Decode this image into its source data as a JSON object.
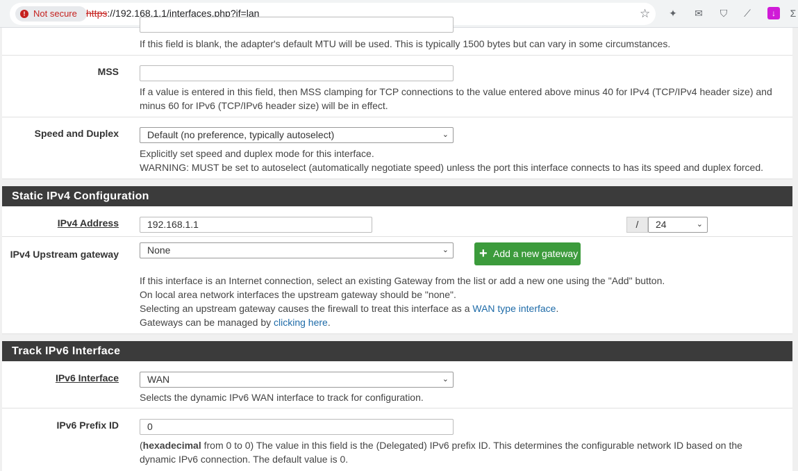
{
  "browser": {
    "security_chip": "Not secure",
    "url_scheme": "https",
    "url_rest": "://192.168.1.1/interfaces.php?if=lan"
  },
  "mtu_row": {
    "help": "If this field is blank, the adapter's default MTU will be used. This is typically 1500 bytes but can vary in some circumstances."
  },
  "mss": {
    "label": "MSS",
    "value": "",
    "help": "If a value is entered in this field, then MSS clamping for TCP connections to the value entered above minus 40 for IPv4 (TCP/IPv4 header size) and minus 60 for IPv6 (TCP/IPv6 header size) will be in effect."
  },
  "speed_duplex": {
    "label": "Speed and Duplex",
    "selected": "Default (no preference, typically autoselect)",
    "help1": "Explicitly set speed and duplex mode for this interface.",
    "help2": "WARNING: MUST be set to autoselect (automatically negotiate speed) unless the port this interface connects to has its speed and duplex forced."
  },
  "static_ipv4": {
    "heading": "Static IPv4 Configuration",
    "address_label": "IPv4 Address",
    "address_value": "192.168.1.1",
    "slash": "/",
    "prefix_selected": "24",
    "gateway_label": "IPv4 Upstream gateway",
    "gateway_selected": "None",
    "add_gateway_button": "Add a new gateway",
    "help1": "If this interface is an Internet connection, select an existing Gateway from the list or add a new one using the \"Add\" button.",
    "help2": "On local area network interfaces the upstream gateway should be \"none\".",
    "help3_pre": "Selecting an upstream gateway causes the firewall to treat this interface as a ",
    "help3_link": "WAN type interface",
    "help3_post": ".",
    "help4_pre": "Gateways can be managed by ",
    "help4_link": "clicking here",
    "help4_post": "."
  },
  "track_ipv6": {
    "heading": "Track IPv6 Interface",
    "interface_label": "IPv6 Interface",
    "interface_selected": "WAN",
    "interface_help": "Selects the dynamic IPv6 WAN interface to track for configuration.",
    "prefix_label": "IPv6 Prefix ID",
    "prefix_value": "0",
    "prefix_help_bold": "hexadecimal",
    "prefix_help_rest": " from 0 to 0) The value in this field is the (Delegated) IPv6 prefix ID. This determines the configurable network ID based on the dynamic IPv6 connection. The default value is 0.",
    "prefix_help_open": "("
  }
}
